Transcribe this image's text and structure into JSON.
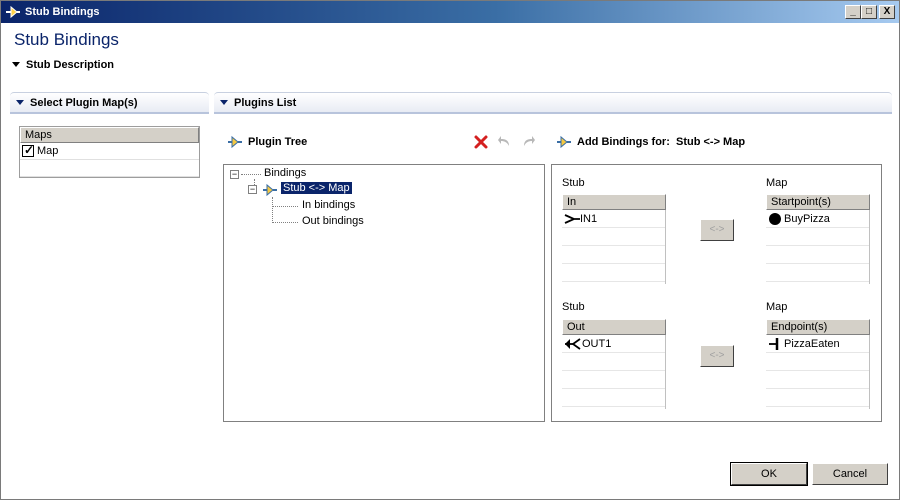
{
  "window": {
    "title": "Stub Bindings",
    "controls": {
      "minimize": "_",
      "maximize": "□",
      "close": "X"
    }
  },
  "page_title": "Stub Bindings",
  "stub_description": {
    "label": "Stub Description"
  },
  "select_plugin_map": {
    "header": "Select Plugin Map(s)",
    "column": "Maps",
    "items": [
      {
        "label": "Map",
        "checked": true
      }
    ]
  },
  "plugins_list": {
    "header": "Plugins List",
    "plugin_tree_label": "Plugin Tree",
    "add_bindings_label": "Add Bindings for:",
    "add_bindings_target": "Stub <-> Map",
    "tree": {
      "root": "Bindings",
      "node": "Stub <-> Map",
      "children": [
        "In bindings",
        "Out bindings"
      ]
    }
  },
  "bindings": {
    "in": {
      "stub_label": "Stub",
      "stub_column": "In",
      "stub_items": [
        "IN1"
      ],
      "map_label": "Map",
      "map_column": "Startpoint(s)",
      "map_items": [
        "BuyPizza"
      ],
      "connect_label": "<->"
    },
    "out": {
      "stub_label": "Stub",
      "stub_column": "Out",
      "stub_items": [
        "OUT1"
      ],
      "map_label": "Map",
      "map_column": "Endpoint(s)",
      "map_items": [
        "PizzaEaten"
      ],
      "connect_label": "<->"
    }
  },
  "buttons": {
    "ok": "OK",
    "cancel": "Cancel"
  },
  "colors": {
    "title_bar": "#0a246a",
    "selection": "#0a246a",
    "delete_icon": "#d42020"
  }
}
